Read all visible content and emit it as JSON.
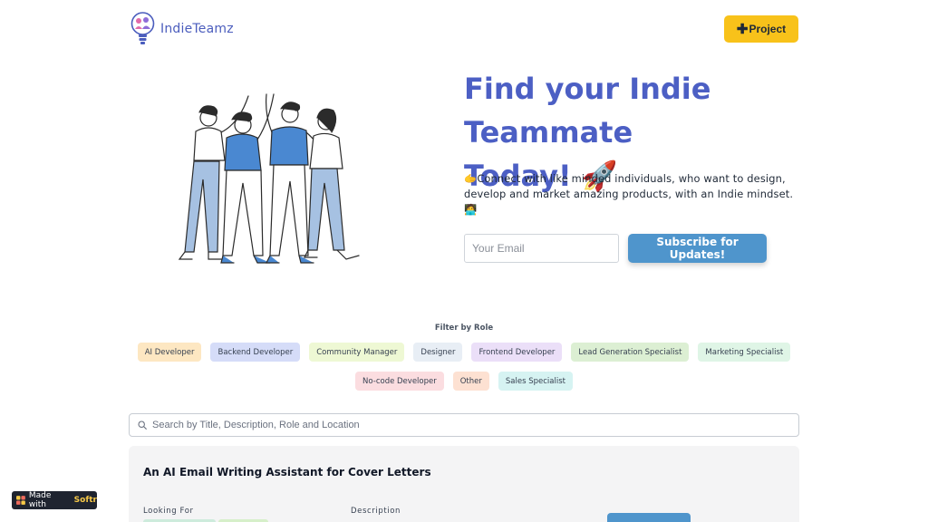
{
  "header": {
    "logo_text": "IndieTeamz",
    "project_button": "Project",
    "project_button_icon": "plus-icon"
  },
  "hero": {
    "title_line1": "Find your Indie Teammate",
    "title_line2": "Today! 🚀",
    "subtitle": "🫱Connect with like minded individuals, who want to design, develop and market amazing products, with an Indie mindset. 🧑‍💻",
    "email_placeholder": "Your Email",
    "subscribe_button": "Subscribe for Updates!"
  },
  "filter": {
    "label": "Filter by Role",
    "row1": [
      {
        "label": "AI Developer",
        "bg": "#fde7c2"
      },
      {
        "label": "Backend Developer",
        "bg": "#d5dcf8"
      },
      {
        "label": "Community Manager",
        "bg": "#eef8d4"
      },
      {
        "label": "Designer",
        "bg": "#e8eef5"
      },
      {
        "label": "Frontend Developer",
        "bg": "#ebdff8"
      },
      {
        "label": "Lead Generation Specialist",
        "bg": "#dcefd3"
      },
      {
        "label": "Marketing Specialist",
        "bg": "#dff5e6"
      }
    ],
    "row2": [
      {
        "label": "No-code Developer",
        "bg": "#fbdde0"
      },
      {
        "label": "Other",
        "bg": "#fde1d2"
      },
      {
        "label": "Sales Specialist",
        "bg": "#d6f3f2"
      }
    ]
  },
  "search": {
    "placeholder": "Search by Title, Description, Role and Location"
  },
  "card": {
    "title": "An AI Email Writing Assistant for Cover Letters",
    "looking_for_label": "Looking For",
    "description_label": "Description"
  },
  "badge": {
    "made_with": "Made with",
    "brand": "Softr"
  },
  "colors": {
    "accent": "#4c5fc4",
    "button_blue": "#4f95cc",
    "project_yellow": "#f8c21a"
  }
}
